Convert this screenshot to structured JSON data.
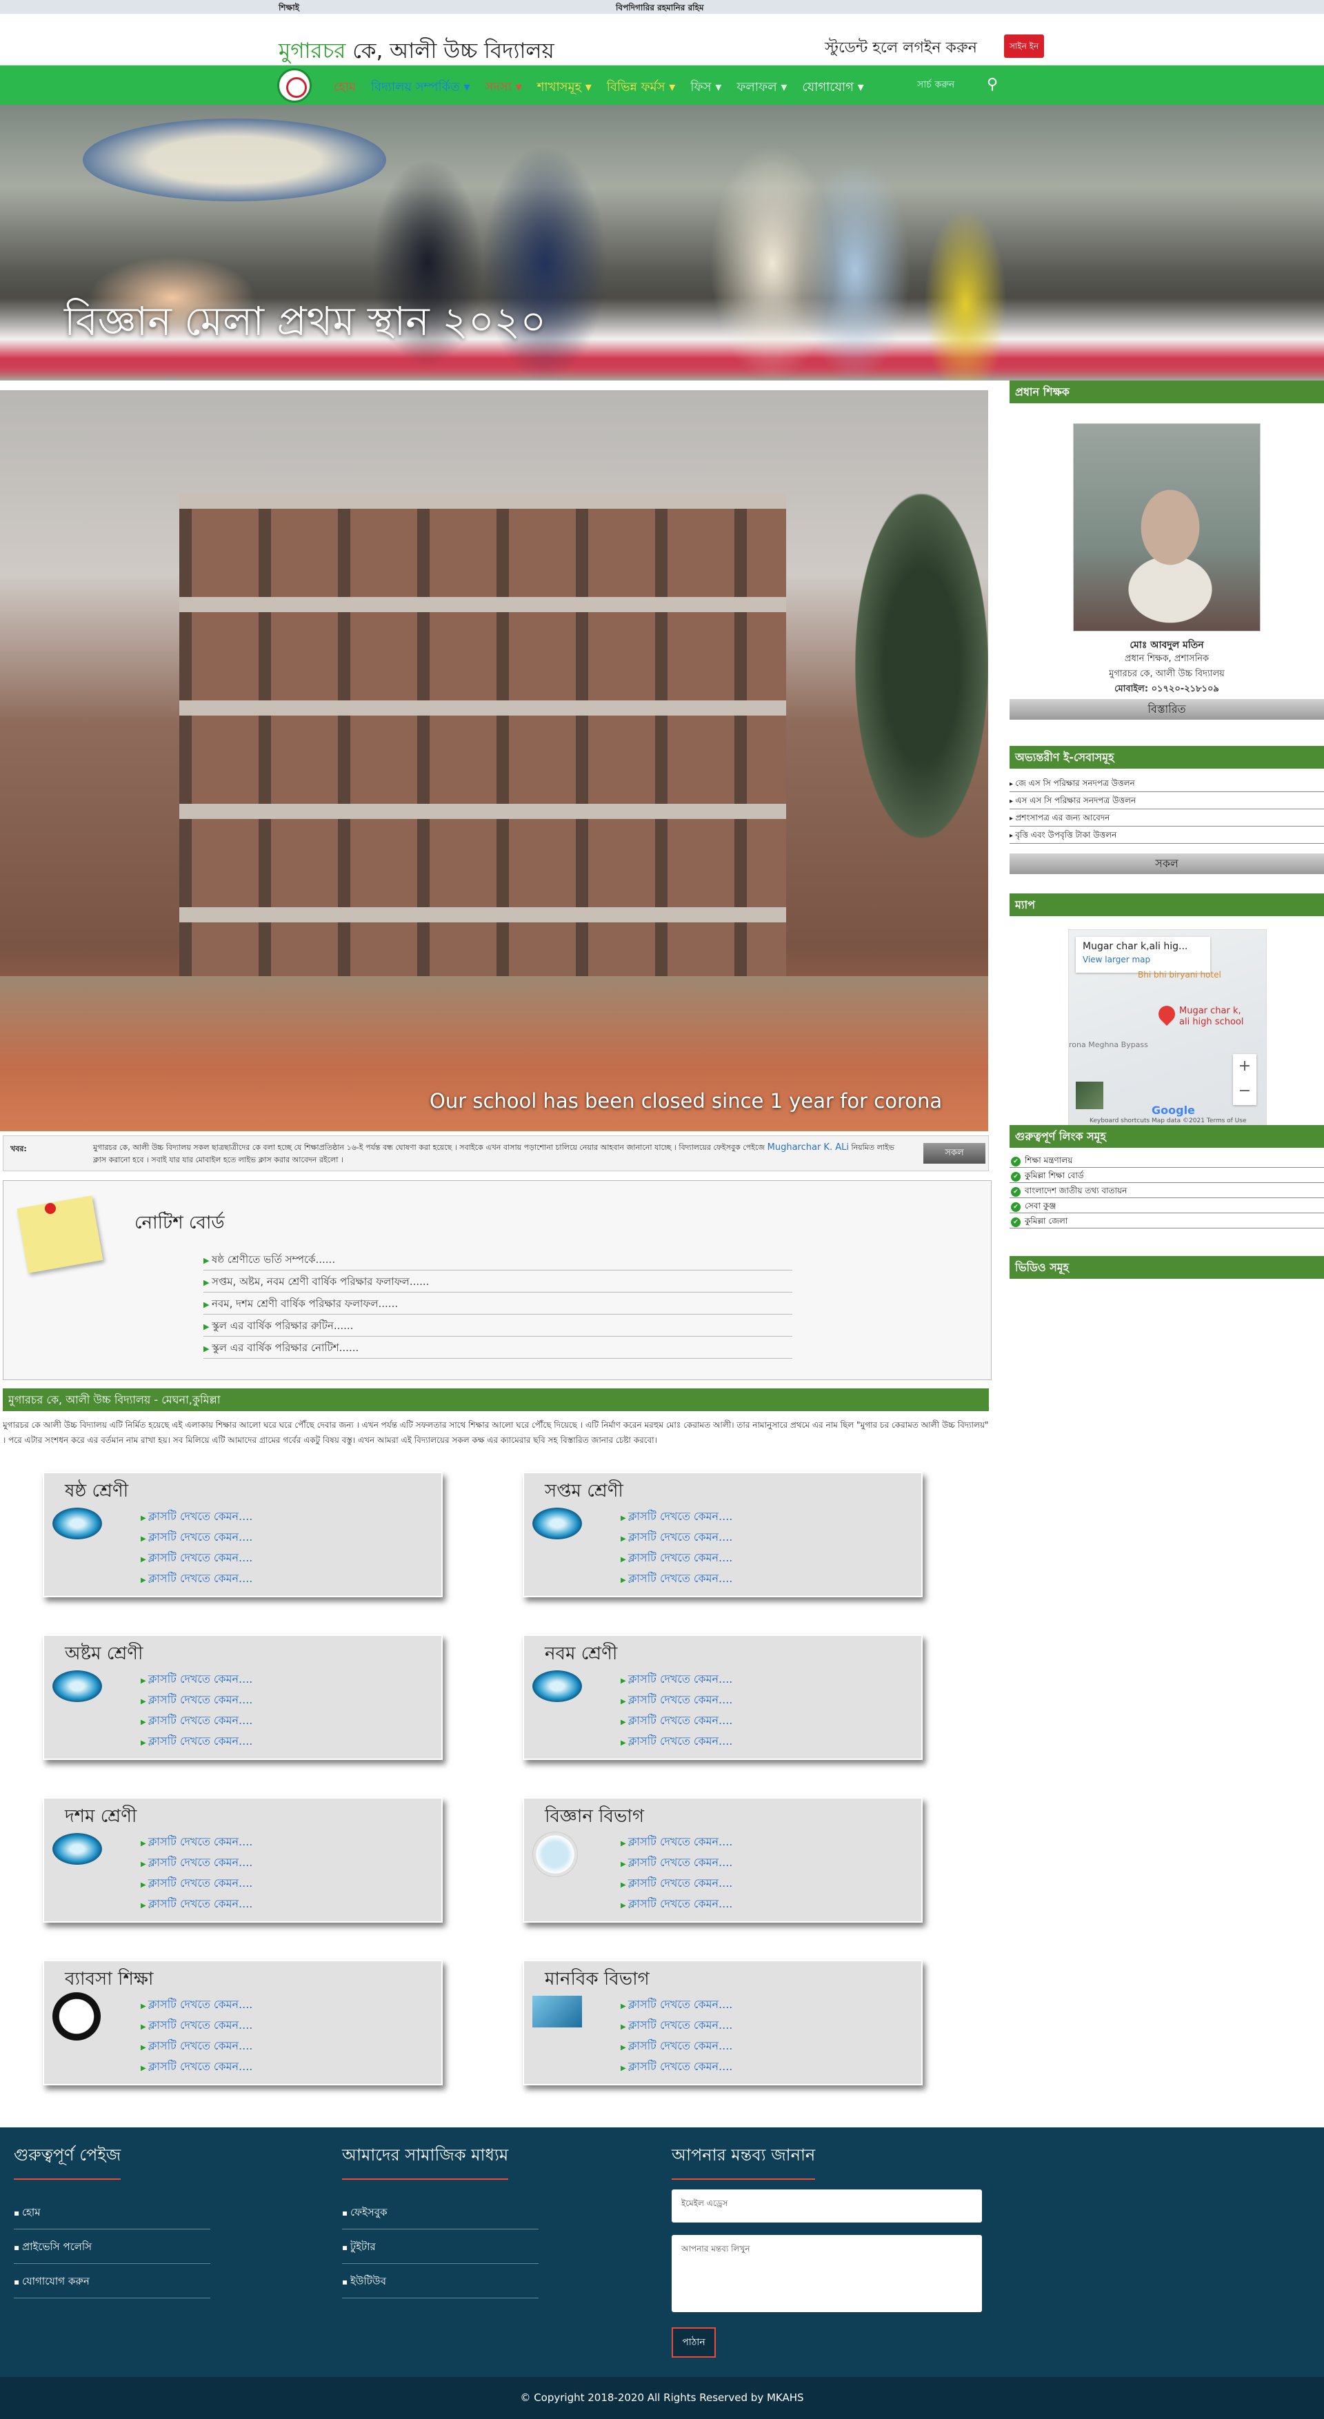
{
  "topbar": {
    "left": "শিক্ষাই",
    "right": "বিপদিগারির রহমানির রহিম"
  },
  "header": {
    "title_green": "মুগারচর",
    "title_rest": " কে, আলী উচ্চ বিদ্যালয়",
    "login_text": "স্টুডেন্ট হলে লগইন করুন",
    "register": "সাইন ইন"
  },
  "nav": {
    "items": [
      {
        "label": "হোম",
        "color": "#e94b3c"
      },
      {
        "label": "বিদ্যালয় সম্পর্কিত ▾",
        "color": "#1a7ee8"
      },
      {
        "label": "সদস্য ▾",
        "color": "#e94b3c"
      },
      {
        "label": "শাখাসমূহ ▾",
        "color": "#f7e04b"
      },
      {
        "label": "বিভিন্ন ফর্মস ▾",
        "color": "#f7e04b"
      },
      {
        "label": "ফিস ▾",
        "color": "#dff5e4"
      },
      {
        "label": "ফলাফল ▾",
        "color": "#dff5e4"
      },
      {
        "label": "যোগাযোগ ▾",
        "color": "#ffffff"
      }
    ],
    "search_placeholder": "সার্চ করুন"
  },
  "hero": {
    "caption": "বিজ্ঞান মেলা প্রথম স্থান ২০২০"
  },
  "slider": {
    "caption": "Our school has been closed since 1 year for corona"
  },
  "news": {
    "label": "খবর:",
    "text": "মুগারচর কে, আলী উচ্চ বিদ্যালয় সকল ছাত্রছাত্রীদের কে বলা হচ্ছে যে শিক্ষাপ্রতিষ্ঠান ১৬-ই পর্যন্ত বন্ধ ঘোষণা করা হয়েছে । সবাইকে এখন বাসায় পড়াশোনা চালিয়ে নেয়ার আহবান জানানো যাচ্ছে । বিদ্যালয়ের ফেইসবুক পেইজে ",
    "link": "Mugharchar K. ALi",
    "text2": " নিয়মিত লাইভ ক্লাস করানো হবে । সবাই যার যার মোবাইল হতে লাইভ ক্লাস করার আবেদন রইলো ।",
    "button": "সকল"
  },
  "notice": {
    "title": "নোটিশ বোর্ড",
    "items": [
      "ষষ্ঠ শ্রেণীতে ভর্তি সম্পর্কে......",
      "সপ্তম, অষ্টম, নবম শ্রেণী বার্ষিক পরিক্ষার ফলাফল......",
      "নবম, দশম শ্রেণী বার্ষিক পরিক্ষার ফলাফল......",
      "স্কুল এর বার্ষিক পরিক্ষার রুটিন......",
      "স্কুল এর বার্ষিক পরিক্ষার নোটিশ......"
    ]
  },
  "about": {
    "heading": "মুগারচর কে, আলী উচ্চ বিদ্যালয় - মেঘনা,কুমিল্লা",
    "text": "মুগারচর কে আলী উচ্চ বিদ্যালয় এটি নির্মিত হয়েছে এই এলাকায় শিক্ষার আলো ঘরে ঘরে পৌঁছে দেবার জন্য । এখন পর্যন্ত এটি সফলতার সাথে শিক্ষার আলো ঘরে পৌঁছে দিয়েছে । এটি নির্মাণ করেন মরহুম মোঃ কেরামত আলী। তার নামানুসারে প্রথমে এর নাম ছিল \"মুগার চর কেরামত আলী উচ্চ বিদ্যালয়\" । পরে এটার সংশধন করে এর বর্তমান নাম রাখা হয়। সব মিলিয়ে এটি আমাদের গ্রামের গর্বের একটু বিষয় বস্তু। এখন আমরা এই বিদ্যালয়ের সকল কক্ষ এর ক্যামেরার ছবি সহ বিস্তারিত জানার চেষ্টা করবো।"
  },
  "classes": [
    {
      "title": "ষষ্ঠ শ্রেণী",
      "icon": "water-drop-icon",
      "links": [
        "ক্লাসটি দেখতে কেমন....",
        "ক্লাসটি দেখতে কেমন....",
        "ক্লাসটি দেখতে কেমন....",
        "ক্লাসটি দেখতে কেমন...."
      ]
    },
    {
      "title": "সপ্তম শ্রেণী",
      "icon": "water-drop-icon",
      "links": [
        "ক্লাসটি দেখতে কেমন....",
        "ক্লাসটি দেখতে কেমন....",
        "ক্লাসটি দেখতে কেমন....",
        "ক্লাসটি দেখতে কেমন...."
      ]
    },
    {
      "title": "অষ্টম শ্রেণী",
      "icon": "water-drop-icon",
      "links": [
        "ক্লাসটি দেখতে কেমন....",
        "ক্লাসটি দেখতে কেমন....",
        "ক্লাসটি দেখতে কেমন....",
        "ক্লাসটি দেখতে কেমন...."
      ]
    },
    {
      "title": "নবম শ্রেণী",
      "icon": "water-drop-icon",
      "links": [
        "ক্লাসটি দেখতে কেমন....",
        "ক্লাসটি দেখতে কেমন....",
        "ক্লাসটি দেখতে কেমন....",
        "ক্লাসটি দেখতে কেমন...."
      ]
    },
    {
      "title": "দশম শ্রেণী",
      "icon": "water-drop-icon",
      "links": [
        "ক্লাসটি দেখতে কেমন....",
        "ক্লাসটি দেখতে কেমন....",
        "ক্লাসটি দেখতে কেমন....",
        "ক্লাসটি দেখতে কেমন...."
      ]
    },
    {
      "title": "বিজ্ঞান বিভাগ",
      "icon": "science-icon",
      "links": [
        "ক্লাসটি দেখতে কেমন....",
        "ক্লাসটি দেখতে কেমন....",
        "ক্লাসটি দেখতে কেমন....",
        "ক্লাসটি দেখতে কেমন...."
      ]
    },
    {
      "title": "ব্যাবসা শিক্ষা",
      "icon": "business-icon",
      "links": [
        "ক্লাসটি দেখতে কেমন....",
        "ক্লাসটি দেখতে কেমন....",
        "ক্লাসটি দেখতে কেমন....",
        "ক্লাসটি দেখতে কেমন...."
      ]
    },
    {
      "title": "মানবিক বিভাগ",
      "icon": "humanities-icon",
      "links": [
        "ক্লাসটি দেখতে কেমন....",
        "ক্লাসটি দেখতে কেমন....",
        "ক্লাসটি দেখতে কেমন....",
        "ক্লাসটি দেখতে কেমন...."
      ]
    }
  ],
  "sidebar": {
    "principal": {
      "heading": "প্রধান শিক্ষক",
      "name": "মোঃ আবদুল মতিন",
      "role": "প্রধান শিক্ষক, প্রশাসনিক",
      "school": "মুগারচর কে, আলী উচ্চ বিদ্যালয়",
      "phone": "মোবাইল: ০১৭২০-২১৮১০৯",
      "details": "বিস্তারিত"
    },
    "services": {
      "heading": "অভ্যন্তরীণ ই-সেবাসমূহ",
      "items": [
        "জে এস সি পরিক্ষার সনদপত্র উত্তলন",
        "এস এস সি পরিক্ষার সনদপত্র উত্তলন",
        "প্রশংসাপত্র এর জন্য আবেদন",
        "বৃত্তি এবং উপবৃত্তি টাকা উত্তলন"
      ],
      "all_button": "সকল"
    },
    "map": {
      "heading": "ম্যাপ",
      "place": "Mugar char k,ali hig...",
      "larger": "View larger map",
      "hotel": "Bhi bhi biryani hotel",
      "pin_label": "Mugar char k,\nali high school",
      "road": "rona Meghna Bypass",
      "footer": "Keyboard shortcuts   Map data ©2021   Terms of Use",
      "brand": "Google"
    },
    "links": {
      "heading": "গুরুত্বপূর্ণ লিংক সমূহ",
      "items": [
        "শিক্ষা মন্ত্রণালয়",
        "কুমিল্লা শিক্ষা বোর্ড",
        "বাংলাদেশ জাতীয় তথ্য বাতায়ন",
        "সেবা কুঞ্জ",
        "কুমিল্লা জেলা"
      ]
    },
    "videos": {
      "heading": "ভিডিও সমূহ"
    }
  },
  "footer": {
    "important": {
      "heading": "গুরুত্বপূর্ণ পেইজ",
      "items": [
        "হোম",
        "প্রাইভেসি পলেসি",
        "যোগাযোগ করুন"
      ]
    },
    "social": {
      "heading": "আমাদের সামাজিক মাধ্যম",
      "items": [
        "ফেইসবুক",
        "টুইটার",
        "ইউটিউব"
      ]
    },
    "feedback": {
      "heading": "আপনার মন্তব্য জানান",
      "email_placeholder": "ইমেইল এড্রেস",
      "comment_placeholder": "আপনার মন্তব্য লিখুন",
      "submit": "পাঠান"
    },
    "copyright": "© Copyright 2018-2020 All Rights Reserved by MKAHS"
  }
}
